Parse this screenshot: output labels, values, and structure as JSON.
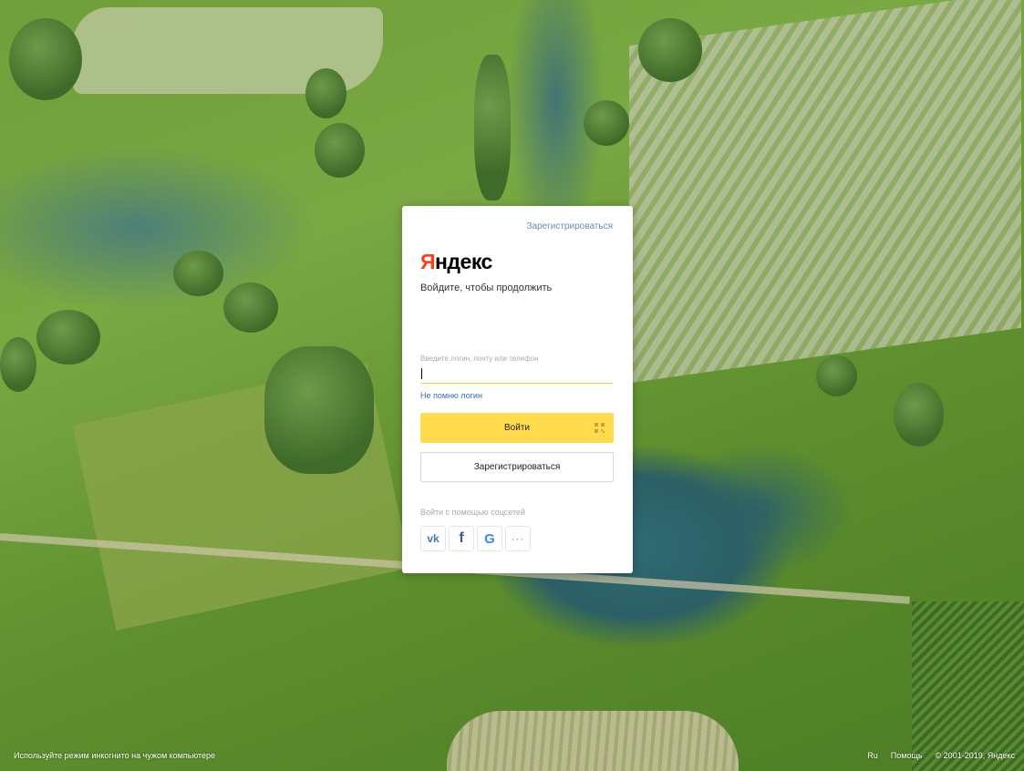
{
  "card": {
    "register_link": "Зарегистрироваться",
    "logo_first_letter": "Я",
    "logo_rest": "ндекс",
    "subtitle": "Войдите, чтобы продолжить",
    "login_label": "Введите логин, почту или телефон",
    "login_value": "",
    "forgot_link": "Не помню логин",
    "login_button": "Войти",
    "register_button": "Зарегистрироваться",
    "social_label": "Войти с помощью соцсетей",
    "social": {
      "vk": "vk",
      "facebook": "f",
      "google": "G",
      "more": "···"
    }
  },
  "footer": {
    "incognito_hint": "Используйте режим инкогнито на чужом компьютере",
    "lang": "Ru",
    "help": "Помощь",
    "copyright": "© 2001-2019, Яндекс"
  },
  "colors": {
    "brand_red": "#fc3f1d",
    "button_yellow": "#ffdb4d",
    "link_blue": "#3a6ab2"
  },
  "icons": [
    "qr-code-icon",
    "vk-icon",
    "facebook-icon",
    "google-icon",
    "more-icon"
  ]
}
